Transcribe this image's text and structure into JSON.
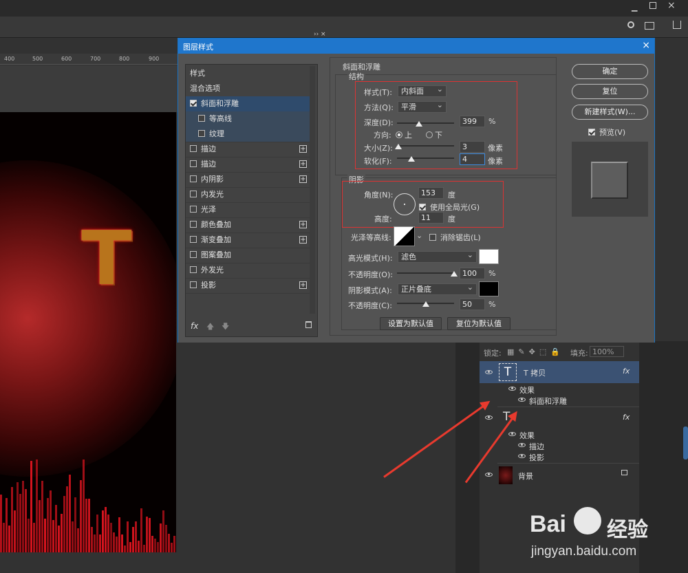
{
  "ruler": [
    "400",
    "500",
    "600",
    "700",
    "800",
    "900"
  ],
  "dialog": {
    "title": "图层样式",
    "close": "×"
  },
  "styles": {
    "items": [
      {
        "label": "样式",
        "check": "none",
        "plus": false
      },
      {
        "label": "混合选项",
        "check": "none",
        "plus": false
      },
      {
        "label": "斜面和浮雕",
        "check": "on",
        "plus": false
      },
      {
        "label": "等高线",
        "check": "off",
        "plus": false
      },
      {
        "label": "纹理",
        "check": "off",
        "plus": false
      },
      {
        "label": "描边",
        "check": "off",
        "plus": true
      },
      {
        "label": "描边",
        "check": "off",
        "plus": true
      },
      {
        "label": "内阴影",
        "check": "off",
        "plus": true
      },
      {
        "label": "内发光",
        "check": "off",
        "plus": false
      },
      {
        "label": "光泽",
        "check": "off",
        "plus": false
      },
      {
        "label": "颜色叠加",
        "check": "off",
        "plus": true
      },
      {
        "label": "渐变叠加",
        "check": "off",
        "plus": true
      },
      {
        "label": "图案叠加",
        "check": "off",
        "plus": false
      },
      {
        "label": "外发光",
        "check": "off",
        "plus": false
      },
      {
        "label": "投影",
        "check": "off",
        "plus": true
      }
    ],
    "fx": "fx"
  },
  "bevel": {
    "title": "斜面和浮雕",
    "structure": "结构",
    "style_label": "样式(T):",
    "style_value": "内斜面",
    "technique_label": "方法(Q):",
    "technique_value": "平滑",
    "depth_label": "深度(D):",
    "depth_value": "399",
    "depth_unit": "%",
    "depth_pos": 0.38,
    "direction_label": "方向:",
    "dir_up": "上",
    "dir_down": "下",
    "size_label": "大小(Z):",
    "size_value": "3",
    "size_unit": "像素",
    "size_pos": 0.02,
    "soften_label": "软化(F):",
    "soften_value": "4",
    "soften_unit": "像素",
    "soften_pos": 0.25
  },
  "shading": {
    "title": "阴影",
    "angle_label": "角度(N):",
    "angle_value": "153",
    "angle_unit": "度",
    "global_light": "使用全局光(G)",
    "altitude_label": "高度:",
    "altitude_value": "11",
    "altitude_unit": "度",
    "gloss_label": "光泽等高线:",
    "antialias": "消除锯齿(L)",
    "highlight_label": "高光模式(H):",
    "highlight_value": "滤色",
    "highlight_color": "#ffffff",
    "hl_opacity_label": "不透明度(O):",
    "hl_opacity_value": "100",
    "hl_opacity_unit": "%",
    "hl_opacity_pos": 1.0,
    "shadow_label": "阴影模式(A):",
    "shadow_value": "正片叠底",
    "shadow_color": "#000000",
    "sh_opacity_label": "不透明度(C):",
    "sh_opacity_value": "50",
    "sh_opacity_unit": "%",
    "sh_opacity_pos": 0.5,
    "set_default": "设置为默认值",
    "reset_default": "复位为默认值"
  },
  "buttons": {
    "ok": "确定",
    "reset": "复位",
    "new_style": "新建样式(W)...",
    "preview": "预览(V)"
  },
  "layers": {
    "lock_label": "锁定:",
    "fill_label": "填充:",
    "fill_value": "100%",
    "rows": [
      {
        "name": "T 拷贝",
        "fx": "fx"
      },
      {
        "name": "效果"
      },
      {
        "name": "斜面和浮雕"
      },
      {
        "name": "",
        "fx": "fx"
      },
      {
        "name": "效果"
      },
      {
        "name": "描边"
      },
      {
        "name": "投影"
      },
      {
        "name": "背景"
      }
    ]
  },
  "canvas_letter": "T",
  "watermark": {
    "brand": "Bai",
    "brand2": "经验",
    "url": "jingyan.baidu.com"
  }
}
